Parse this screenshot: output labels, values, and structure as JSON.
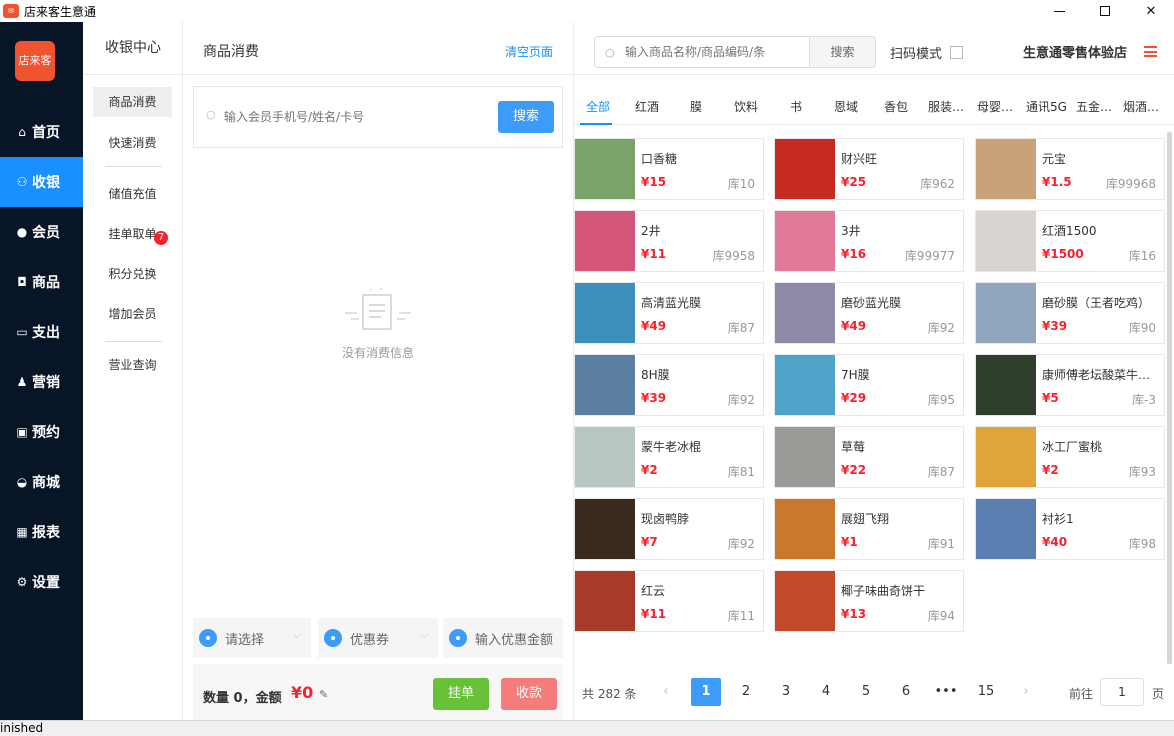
{
  "window": {
    "title": "店来客生意通",
    "logo_text": "店来客"
  },
  "sidebar": {
    "items": [
      {
        "icon": "home-icon",
        "glyph": "⌂",
        "label": "首页"
      },
      {
        "icon": "sitemap-icon",
        "glyph": "⚇",
        "label": "收银"
      },
      {
        "icon": "user-icon",
        "glyph": "●",
        "label": "会员"
      },
      {
        "icon": "gift-icon",
        "glyph": "◘",
        "label": "商品"
      },
      {
        "icon": "credit-card-icon",
        "glyph": "▭",
        "label": "支出"
      },
      {
        "icon": "users-icon",
        "glyph": "♟",
        "label": "营销"
      },
      {
        "icon": "desktop-icon",
        "glyph": "▣",
        "label": "预约"
      },
      {
        "icon": "inbox-icon",
        "glyph": "◒",
        "label": "商城"
      },
      {
        "icon": "bar-chart-icon",
        "glyph": "▦",
        "label": "报表"
      },
      {
        "icon": "gear-icon",
        "glyph": "⚙",
        "label": "设置"
      }
    ]
  },
  "subnav": {
    "title": "收银中心",
    "items": [
      {
        "label": "商品消费"
      },
      {
        "label": "快速消费"
      },
      {
        "label": "储值充值"
      },
      {
        "label": "挂单取单"
      },
      {
        "label": "积分兑换"
      },
      {
        "label": "增加会员"
      },
      {
        "label": "营业查询"
      }
    ],
    "pending_badge": "7"
  },
  "order": {
    "title": "商品消费",
    "clear_label": "清空页面",
    "member_placeholder": "输入会员手机号/姓名/卡号",
    "member_search_label": "搜索",
    "empty_text": "没有消费信息",
    "select_placeholder": "请选择",
    "coupon_placeholder": "优惠券",
    "discount_placeholder": "输入优惠金额",
    "summary_text": "数量 0，金额",
    "total_amount": "¥0",
    "hold_label": "挂单",
    "pay_label": "收款"
  },
  "catalog": {
    "search_placeholder": "输入商品名称/商品编码/条",
    "search_label": "搜索",
    "scan_mode_label": "扫码模式",
    "shop_name": "生意通零售体验店",
    "categories": [
      "全部",
      "红酒",
      "膜",
      "饮料",
      "书",
      "恩域",
      "香包",
      "服装…",
      "母婴…",
      "通讯5G",
      "五金…",
      "烟酒…"
    ],
    "products": [
      {
        "name": "口香糖",
        "price": "¥15",
        "stock": "库10",
        "thumb": "#7aa36a"
      },
      {
        "name": "财兴旺",
        "price": "¥25",
        "stock": "库962",
        "thumb": "#c62b22"
      },
      {
        "name": "元宝",
        "price": "¥1.5",
        "stock": "库99968",
        "thumb": "#c9a27a"
      },
      {
        "name": "2井",
        "price": "¥11",
        "stock": "库9958",
        "thumb": "#d4577a"
      },
      {
        "name": "3井",
        "price": "¥16",
        "stock": "库99977",
        "thumb": "#e07a98"
      },
      {
        "name": "红酒1500",
        "price": "¥1500",
        "stock": "库16",
        "thumb": "#d9d4d0"
      },
      {
        "name": "高清蓝光膜",
        "price": "¥49",
        "stock": "库87",
        "thumb": "#3b8fb8"
      },
      {
        "name": "磨砂蓝光膜",
        "price": "¥49",
        "stock": "库92",
        "thumb": "#8e8aa8"
      },
      {
        "name": "磨砂膜（王者吃鸡）",
        "price": "¥39",
        "stock": "库90",
        "thumb": "#8fa6bd"
      },
      {
        "name": "8H膜",
        "price": "¥39",
        "stock": "库92",
        "thumb": "#5b7fa0"
      },
      {
        "name": "7H膜",
        "price": "¥29",
        "stock": "库95",
        "thumb": "#4ea3c9"
      },
      {
        "name": "康师傅老坛酸菜牛…",
        "price": "¥5",
        "stock": "库-3",
        "thumb": "#2f3e2c"
      },
      {
        "name": "蒙牛老冰棍",
        "price": "¥2",
        "stock": "库81",
        "thumb": "#b9c7c2"
      },
      {
        "name": "草莓",
        "price": "¥22",
        "stock": "库87",
        "thumb": "#9a9a96"
      },
      {
        "name": "冰工厂蜜桃",
        "price": "¥2",
        "stock": "库93",
        "thumb": "#e0a43a"
      },
      {
        "name": "现卤鸭脖",
        "price": "¥7",
        "stock": "库92",
        "thumb": "#3a2a1e"
      },
      {
        "name": "展翅飞翔",
        "price": "¥1",
        "stock": "库91",
        "thumb": "#c9782e"
      },
      {
        "name": "衬衫1",
        "price": "¥40",
        "stock": "库98",
        "thumb": "#5a7fb0"
      },
      {
        "name": "红云",
        "price": "¥11",
        "stock": "库11",
        "thumb": "#a83a2a"
      },
      {
        "name": "椰子味曲奇饼干",
        "price": "¥13",
        "stock": "库94",
        "thumb": "#c24a2a"
      }
    ],
    "total_text": "共 282 条",
    "pages": [
      "1",
      "2",
      "3",
      "4",
      "5",
      "6",
      "•••",
      "15"
    ],
    "current_page": "1",
    "goto_label": "前往",
    "goto_value": "1",
    "goto_unit": "页"
  },
  "status": {
    "text": "inished"
  },
  "colors": {
    "accent": "#1890ff",
    "sidebar": "#071526",
    "price": "#f5222d",
    "hold": "#67c23a",
    "pay": "#f67c7c",
    "brand": "#f0532f"
  }
}
